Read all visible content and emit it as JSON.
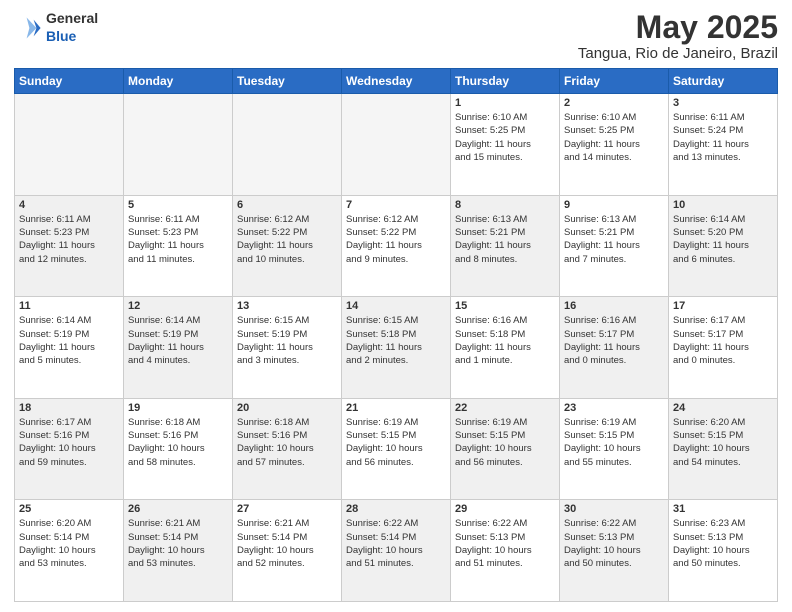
{
  "header": {
    "logo_general": "General",
    "logo_blue": "Blue",
    "month": "May 2025",
    "location": "Tangua, Rio de Janeiro, Brazil"
  },
  "weekdays": [
    "Sunday",
    "Monday",
    "Tuesday",
    "Wednesday",
    "Thursday",
    "Friday",
    "Saturday"
  ],
  "weeks": [
    [
      {
        "day": "",
        "info": "",
        "empty": true
      },
      {
        "day": "",
        "info": "",
        "empty": true
      },
      {
        "day": "",
        "info": "",
        "empty": true
      },
      {
        "day": "",
        "info": "",
        "empty": true
      },
      {
        "day": "1",
        "info": "Sunrise: 6:10 AM\nSunset: 5:25 PM\nDaylight: 11 hours\nand 15 minutes."
      },
      {
        "day": "2",
        "info": "Sunrise: 6:10 AM\nSunset: 5:25 PM\nDaylight: 11 hours\nand 14 minutes."
      },
      {
        "day": "3",
        "info": "Sunrise: 6:11 AM\nSunset: 5:24 PM\nDaylight: 11 hours\nand 13 minutes."
      }
    ],
    [
      {
        "day": "4",
        "info": "Sunrise: 6:11 AM\nSunset: 5:23 PM\nDaylight: 11 hours\nand 12 minutes.",
        "shaded": true
      },
      {
        "day": "5",
        "info": "Sunrise: 6:11 AM\nSunset: 5:23 PM\nDaylight: 11 hours\nand 11 minutes."
      },
      {
        "day": "6",
        "info": "Sunrise: 6:12 AM\nSunset: 5:22 PM\nDaylight: 11 hours\nand 10 minutes.",
        "shaded": true
      },
      {
        "day": "7",
        "info": "Sunrise: 6:12 AM\nSunset: 5:22 PM\nDaylight: 11 hours\nand 9 minutes."
      },
      {
        "day": "8",
        "info": "Sunrise: 6:13 AM\nSunset: 5:21 PM\nDaylight: 11 hours\nand 8 minutes.",
        "shaded": true
      },
      {
        "day": "9",
        "info": "Sunrise: 6:13 AM\nSunset: 5:21 PM\nDaylight: 11 hours\nand 7 minutes."
      },
      {
        "day": "10",
        "info": "Sunrise: 6:14 AM\nSunset: 5:20 PM\nDaylight: 11 hours\nand 6 minutes.",
        "shaded": true
      }
    ],
    [
      {
        "day": "11",
        "info": "Sunrise: 6:14 AM\nSunset: 5:19 PM\nDaylight: 11 hours\nand 5 minutes."
      },
      {
        "day": "12",
        "info": "Sunrise: 6:14 AM\nSunset: 5:19 PM\nDaylight: 11 hours\nand 4 minutes.",
        "shaded": true
      },
      {
        "day": "13",
        "info": "Sunrise: 6:15 AM\nSunset: 5:19 PM\nDaylight: 11 hours\nand 3 minutes."
      },
      {
        "day": "14",
        "info": "Sunrise: 6:15 AM\nSunset: 5:18 PM\nDaylight: 11 hours\nand 2 minutes.",
        "shaded": true
      },
      {
        "day": "15",
        "info": "Sunrise: 6:16 AM\nSunset: 5:18 PM\nDaylight: 11 hours\nand 1 minute."
      },
      {
        "day": "16",
        "info": "Sunrise: 6:16 AM\nSunset: 5:17 PM\nDaylight: 11 hours\nand 0 minutes.",
        "shaded": true
      },
      {
        "day": "17",
        "info": "Sunrise: 6:17 AM\nSunset: 5:17 PM\nDaylight: 11 hours\nand 0 minutes."
      }
    ],
    [
      {
        "day": "18",
        "info": "Sunrise: 6:17 AM\nSunset: 5:16 PM\nDaylight: 10 hours\nand 59 minutes.",
        "shaded": true
      },
      {
        "day": "19",
        "info": "Sunrise: 6:18 AM\nSunset: 5:16 PM\nDaylight: 10 hours\nand 58 minutes."
      },
      {
        "day": "20",
        "info": "Sunrise: 6:18 AM\nSunset: 5:16 PM\nDaylight: 10 hours\nand 57 minutes.",
        "shaded": true
      },
      {
        "day": "21",
        "info": "Sunrise: 6:19 AM\nSunset: 5:15 PM\nDaylight: 10 hours\nand 56 minutes."
      },
      {
        "day": "22",
        "info": "Sunrise: 6:19 AM\nSunset: 5:15 PM\nDaylight: 10 hours\nand 56 minutes.",
        "shaded": true
      },
      {
        "day": "23",
        "info": "Sunrise: 6:19 AM\nSunset: 5:15 PM\nDaylight: 10 hours\nand 55 minutes."
      },
      {
        "day": "24",
        "info": "Sunrise: 6:20 AM\nSunset: 5:15 PM\nDaylight: 10 hours\nand 54 minutes.",
        "shaded": true
      }
    ],
    [
      {
        "day": "25",
        "info": "Sunrise: 6:20 AM\nSunset: 5:14 PM\nDaylight: 10 hours\nand 53 minutes."
      },
      {
        "day": "26",
        "info": "Sunrise: 6:21 AM\nSunset: 5:14 PM\nDaylight: 10 hours\nand 53 minutes.",
        "shaded": true
      },
      {
        "day": "27",
        "info": "Sunrise: 6:21 AM\nSunset: 5:14 PM\nDaylight: 10 hours\nand 52 minutes."
      },
      {
        "day": "28",
        "info": "Sunrise: 6:22 AM\nSunset: 5:14 PM\nDaylight: 10 hours\nand 51 minutes.",
        "shaded": true
      },
      {
        "day": "29",
        "info": "Sunrise: 6:22 AM\nSunset: 5:13 PM\nDaylight: 10 hours\nand 51 minutes."
      },
      {
        "day": "30",
        "info": "Sunrise: 6:22 AM\nSunset: 5:13 PM\nDaylight: 10 hours\nand 50 minutes.",
        "shaded": true
      },
      {
        "day": "31",
        "info": "Sunrise: 6:23 AM\nSunset: 5:13 PM\nDaylight: 10 hours\nand 50 minutes."
      }
    ]
  ]
}
